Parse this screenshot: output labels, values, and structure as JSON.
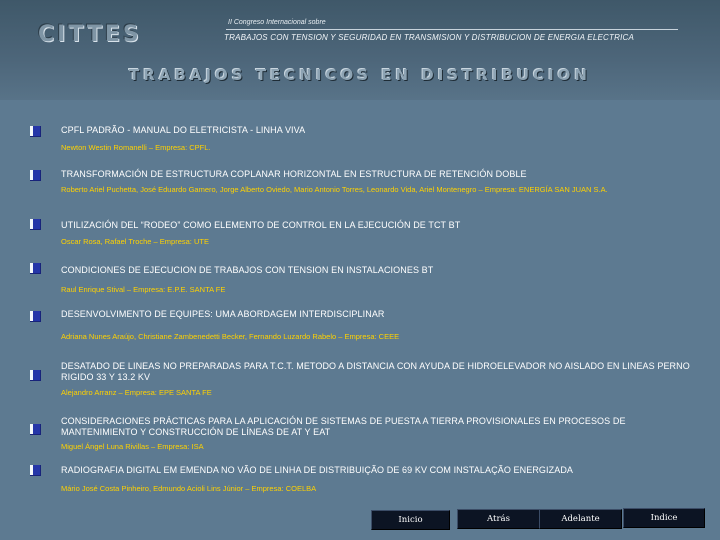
{
  "header": {
    "logo": "CITTES",
    "congress_small": "II Congreso Internacional sobre",
    "congress_main": "TRABAJOS CON TENSION Y SEGURIDAD EN TRANSMISION Y DISTRIBUCION DE ENERGIA ELECTRICA"
  },
  "section_title": "TRABAJOS TECNICOS EN DISTRIBUCION",
  "papers": [
    {
      "title": "CPFL PADRÃO - MANUAL DO ELETRICISTA - LINHA VIVA",
      "authors": "Newton Westin Romanelli – Empresa: CPFL."
    },
    {
      "title": "TRANSFORMACIÓN DE ESTRUCTURA COPLANAR HORIZONTAL EN ESTRUCTURA DE RETENCIÓN DOBLE",
      "authors": "Roberto Ariel Puchetta, José Eduardo Gamero, Jorge Alberto Oviedo, Mario Antonio Torres, Leonardo Vida, Ariel Montenegro – Empresa: ENERGÍA SAN JUAN S.A."
    },
    {
      "title": "UTILIZACIÓN DEL “RODEO” COMO ELEMENTO DE CONTROL EN LA EJECUCIÓN DE TCT BT",
      "authors": "Oscar Rosa, Rafael Troche – Empresa: UTE"
    },
    {
      "title": "CONDICIONES DE EJECUCION DE TRABAJOS CON TENSION EN INSTALACIONES BT",
      "authors": "Raul Enrique Stival – Empresa: E.P.E. SANTA FE"
    },
    {
      "title": "DESENVOLVIMENTO DE EQUIPES: UMA ABORDAGEM INTERDISCIPLINAR",
      "authors": "Adriana Nunes Araújo, Christiane Zambenedetti Becker, Fernando Luzardo Rabelo – Empresa: CEEE"
    },
    {
      "title": "DESATADO DE LINEAS NO PREPARADAS PARA T.C.T. METODO A DISTANCIA CON AYUDA DE HIDROELEVADOR NO AISLADO EN LINEAS PERNO RIGIDO 33 Y 13.2 KV",
      "authors": "Alejandro Arranz – Empresa: EPE SANTA FE"
    },
    {
      "title": "CONSIDERACIONES PRÁCTICAS PARA LA APLICACIÓN DE SISTEMAS DE PUESTA A TIERRA PROVISIONALES EN PROCESOS DE MANTENIMIENTO Y CONSTRUCCIÓN DE LÍNEAS DE AT Y EAT",
      "authors": "Miguel Ángel Luna Rivillas – Empresa: ISA"
    },
    {
      "title": "RADIOGRAFIA DIGITAL EM EMENDA NO VÃO DE LINHA DE DISTRIBUIÇÃO DE 69 KV COM INSTALAÇÃO ENERGIZADA",
      "authors": "Mário José Costa Pinheiro, Edmundo Acioli Lins Júnior – Empresa: COELBA"
    }
  ],
  "nav": {
    "inicio": "Inicio",
    "atras": "Atrás",
    "adelante": "Adelante",
    "indice": "Indice"
  }
}
